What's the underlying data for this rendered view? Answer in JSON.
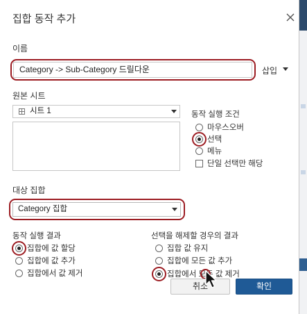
{
  "dialog": {
    "title": "집합 동작 추가",
    "name": {
      "label": "이름",
      "value": "Category -> Sub-Category 드릴다운",
      "insert_label": "삽입"
    },
    "source": {
      "label": "원본 시트",
      "selected": "시트 1"
    },
    "run_on": {
      "label": "동작 실행 조건",
      "options": [
        "마우스오버",
        "선택",
        "메뉴"
      ],
      "selected": "선택",
      "single_select_label": "단일 선택만 해당",
      "single_select_checked": false
    },
    "target": {
      "label": "대상 집합",
      "selected": "Category 집합"
    },
    "result": {
      "label": "동작 실행 결과",
      "options": [
        "집합에 값 할당",
        "집합에 값 추가",
        "집합에서 값 제거"
      ],
      "selected": "집합에 값 할당"
    },
    "clear": {
      "label": "선택을 해제할 경우의 결과",
      "options": [
        "집합 값 유지",
        "집합에 모든 값 추가",
        "집합에서 모든 값 제거"
      ],
      "selected": "집합에서 모든 값 제거"
    },
    "buttons": {
      "cancel": "취소",
      "ok": "확인"
    }
  },
  "icons": {
    "close": "close-icon",
    "sheet": "sheet-icon",
    "dropdown": "chevron-down-icon",
    "pointer": "mouse-pointer-icon"
  },
  "colors": {
    "primary_button": "#1f5a96",
    "annotation": "#9c1c22",
    "background_app_header": "#2c4a6b"
  }
}
